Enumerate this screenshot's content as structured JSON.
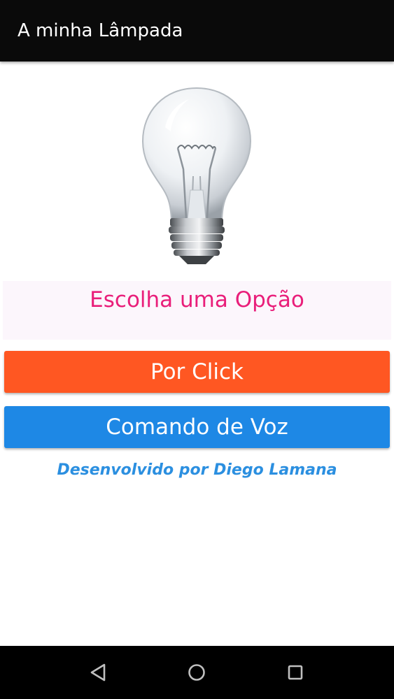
{
  "app_bar": {
    "title": "A minha Lâmpada"
  },
  "main": {
    "bulb_image": "light-bulb-off",
    "prompt": "Escolha uma Opção",
    "buttons": {
      "click_label": "Por Click",
      "voice_label": "Comando de Voz"
    },
    "credit": "Desenvolvido por Diego Lamana"
  },
  "nav_bar": {
    "icons": [
      "back-icon",
      "home-icon",
      "recents-icon"
    ]
  },
  "colors": {
    "app_bar_bg": "#0a0a0a",
    "prompt_text": "#e91e7a",
    "click_button": "#ff5722",
    "voice_button": "#1e88e5",
    "credit_text": "#2b8fe0",
    "nav_bar_bg": "#000000"
  }
}
